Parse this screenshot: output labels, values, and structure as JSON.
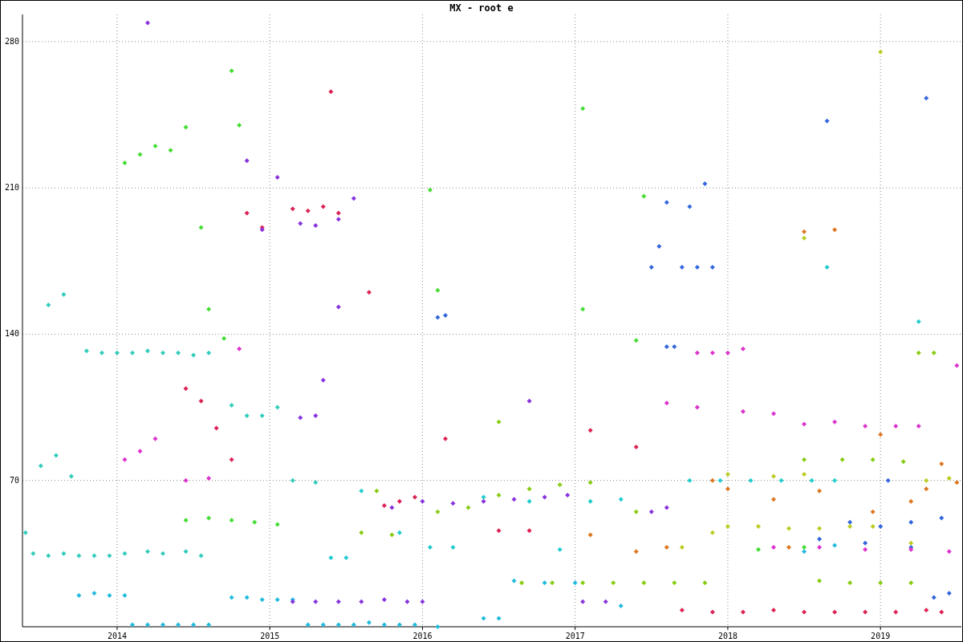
{
  "chart": {
    "chart_data": {
      "type": "scatter",
      "title": "MX - root e",
      "xlim": [
        2013.38,
        2019.53
      ],
      "ylim": [
        0,
        293
      ],
      "xticks": [
        {
          "value": 2014,
          "label": "2014"
        },
        {
          "value": 2015,
          "label": "2015"
        },
        {
          "value": 2016,
          "label": "2016"
        },
        {
          "value": 2017,
          "label": "2017"
        },
        {
          "value": 2018,
          "label": "2018"
        },
        {
          "value": 2019,
          "label": "2019"
        }
      ],
      "yticks": [
        70,
        140,
        210,
        280
      ],
      "grid": true,
      "series": [
        {
          "color": "#33ccbb",
          "x": [
            2013.4,
            2013.45,
            2013.55,
            2013.65,
            2013.75,
            2013.85,
            2013.95,
            2014.05,
            2014.2,
            2014.3,
            2014.45,
            2014.55,
            2013.5,
            2013.6,
            2013.7,
            2013.8,
            2013.9,
            2014.0,
            2014.1,
            2014.2,
            2014.3,
            2014.4,
            2014.5,
            2014.6,
            2013.55,
            2013.65,
            2014.75,
            2014.85,
            2014.95,
            2015.05,
            2015.15,
            2015.3
          ],
          "values": [
            45,
            35,
            34,
            35,
            34,
            34,
            34,
            35,
            36,
            35,
            36,
            34,
            77,
            82,
            72,
            132,
            131,
            131,
            131,
            132,
            131,
            131,
            130,
            131,
            154,
            159,
            106,
            101,
            101,
            105,
            70,
            69
          ]
        },
        {
          "color": "#22bbdd",
          "x": [
            2013.75,
            2013.85,
            2013.95,
            2014.05,
            2014.1,
            2014.2,
            2014.3,
            2014.4,
            2014.5,
            2014.6,
            2014.75,
            2014.85,
            2014.95,
            2015.05,
            2015.15,
            2015.25,
            2015.35,
            2015.45,
            2015.55,
            2015.65,
            2015.75,
            2015.85,
            2015.95,
            2016.1,
            2016.4,
            2016.5,
            2016.6,
            2016.8,
            2017.0,
            2017.3,
            2018.5,
            2018.7
          ],
          "values": [
            15,
            16,
            15,
            15,
            1,
            1,
            1,
            1,
            1,
            1,
            14,
            14,
            13,
            13,
            13,
            1,
            1,
            1,
            1,
            2,
            1,
            1,
            1,
            0,
            4,
            4,
            22,
            21,
            21,
            10,
            36,
            39
          ]
        },
        {
          "color": "#44dd33",
          "x": [
            2014.05,
            2014.15,
            2014.25,
            2014.35,
            2014.45,
            2014.55,
            2014.75,
            2014.8,
            2014.6,
            2014.7,
            2014.45,
            2014.6,
            2014.75,
            2014.9,
            2015.05,
            2016.05,
            2016.1,
            2017.05,
            2017.05,
            2017.4,
            2017.45,
            2018.2,
            2018.5
          ],
          "values": [
            222,
            226,
            230,
            228,
            239,
            191,
            266,
            240,
            152,
            138,
            51,
            52,
            51,
            50,
            49,
            209,
            161,
            152,
            248,
            137,
            206,
            37,
            38
          ]
        },
        {
          "color": "#dd2255",
          "x": [
            2014.45,
            2014.55,
            2014.65,
            2014.75,
            2014.85,
            2014.95,
            2015.15,
            2015.25,
            2015.35,
            2015.45,
            2015.4,
            2015.65,
            2015.75,
            2015.85,
            2015.95,
            2016.15,
            2016.5,
            2016.7,
            2017.1,
            2017.4,
            2017.7,
            2017.9,
            2018.1,
            2018.3,
            2018.5,
            2018.7,
            2018.9,
            2019.1,
            2019.3,
            2019.4
          ],
          "values": [
            114,
            108,
            95,
            80,
            198,
            191,
            200,
            199,
            201,
            198,
            256,
            160,
            58,
            60,
            62,
            90,
            46,
            46,
            94,
            86,
            8,
            7,
            7,
            8,
            7,
            7,
            7,
            7,
            8,
            7
          ]
        },
        {
          "color": "#8833dd",
          "x": [
            2014.85,
            2014.95,
            2015.05,
            2015.2,
            2015.3,
            2015.45,
            2015.55,
            2015.35,
            2015.45,
            2015.2,
            2015.3,
            2015.15,
            2015.3,
            2015.45,
            2015.6,
            2015.75,
            2015.9,
            2016.0,
            2015.8,
            2016.0,
            2016.2,
            2016.4,
            2016.6,
            2016.8,
            2016.95,
            2016.7,
            2017.05,
            2017.2,
            2017.5,
            2017.6,
            2014.2
          ],
          "values": [
            223,
            190,
            215,
            193,
            192,
            195,
            205,
            118,
            153,
            100,
            101,
            12,
            12,
            12,
            12,
            13,
            12,
            12,
            57,
            60,
            59,
            60,
            61,
            62,
            63,
            108,
            12,
            12,
            55,
            57,
            289
          ]
        },
        {
          "color": "#3366dd",
          "x": [
            2016.1,
            2016.15,
            2017.5,
            2017.55,
            2017.6,
            2017.7,
            2017.8,
            2017.9,
            2017.85,
            2017.75,
            2017.6,
            2017.65,
            2018.65,
            2019.05,
            2018.8,
            2019.0,
            2019.2,
            2019.4,
            2019.35,
            2019.45,
            2018.9,
            2019.2,
            2018.6,
            2019.3
          ],
          "values": [
            148,
            149,
            172,
            182,
            203,
            172,
            172,
            172,
            212,
            201,
            134,
            134,
            242,
            70,
            50,
            48,
            50,
            52,
            14,
            16,
            40,
            38,
            42,
            253
          ]
        },
        {
          "color": "#dd33cc",
          "x": [
            2014.05,
            2014.15,
            2014.25,
            2014.45,
            2014.6,
            2014.8,
            2017.8,
            2017.9,
            2018.0,
            2018.1,
            2017.6,
            2017.8,
            2018.1,
            2018.3,
            2018.5,
            2018.7,
            2018.9,
            2019.1,
            2019.25,
            2018.3,
            2018.6,
            2018.9,
            2019.2,
            2019.45,
            2019.5
          ],
          "values": [
            80,
            84,
            90,
            70,
            71,
            133,
            131,
            131,
            131,
            133,
            107,
            105,
            103,
            102,
            97,
            98,
            96,
            96,
            96,
            38,
            38,
            37,
            37,
            36,
            125
          ]
        },
        {
          "color": "#dd7722",
          "x": [
            2017.1,
            2017.4,
            2017.6,
            2017.9,
            2018.0,
            2018.3,
            2018.5,
            2018.7,
            2018.6,
            2018.95,
            2019.2,
            2019.3,
            2019.4,
            2019.5,
            2019.0,
            2018.4
          ],
          "values": [
            44,
            36,
            38,
            70,
            66,
            61,
            189,
            190,
            65,
            55,
            60,
            66,
            78,
            69,
            92,
            38
          ]
        },
        {
          "color": "#bbcc22",
          "x": [
            2017.7,
            2017.9,
            2018.0,
            2018.2,
            2018.4,
            2018.6,
            2018.8,
            2018.95,
            2019.2,
            2018.3,
            2018.5,
            2019.0,
            2019.3,
            2019.45,
            2018.5,
            2018.0
          ],
          "values": [
            38,
            45,
            48,
            48,
            47,
            47,
            48,
            48,
            40,
            72,
            73,
            275,
            70,
            71,
            186,
            73
          ]
        },
        {
          "color": "#88cc11",
          "x": [
            2016.1,
            2016.3,
            2016.5,
            2016.7,
            2016.9,
            2017.1,
            2016.65,
            2016.85,
            2017.05,
            2017.25,
            2017.45,
            2017.65,
            2017.85,
            2015.6,
            2015.8,
            2015.7,
            2016.5,
            2017.4,
            2018.5,
            2018.75,
            2018.95,
            2019.15,
            2018.6,
            2018.8,
            2019.0,
            2019.2,
            2019.25,
            2019.35
          ],
          "values": [
            55,
            57,
            63,
            66,
            68,
            69,
            21,
            21,
            21,
            21,
            21,
            21,
            21,
            45,
            44,
            65,
            98,
            55,
            80,
            80,
            80,
            79,
            22,
            21,
            21,
            21,
            131,
            131
          ]
        },
        {
          "color": "#22cccc",
          "x": [
            2015.4,
            2015.5,
            2015.6,
            2015.85,
            2016.05,
            2016.2,
            2016.4,
            2016.7,
            2016.9,
            2017.1,
            2017.3,
            2017.75,
            2017.95,
            2018.15,
            2018.35,
            2018.55,
            2018.7,
            2019.25,
            2018.65
          ],
          "values": [
            33,
            33,
            65,
            45,
            38,
            38,
            62,
            60,
            37,
            60,
            61,
            70,
            70,
            70,
            70,
            70,
            70,
            146,
            172
          ]
        }
      ]
    }
  }
}
